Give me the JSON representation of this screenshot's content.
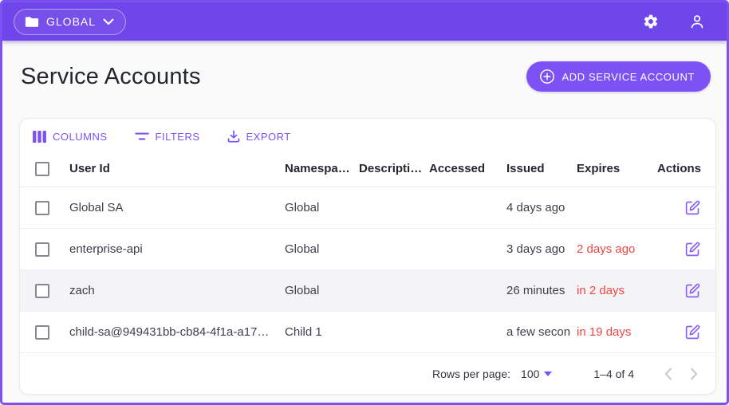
{
  "colors": {
    "appbar_bg": "#6f46e9",
    "accent": "#7c52f5",
    "edit_icon": "#8b5ff6",
    "danger": "#ef4643",
    "page_bg": "#fafafa",
    "highlight_row_bg": "#f4f4f6"
  },
  "appbar": {
    "org_selector": {
      "label": "GLOBAL",
      "icon": "folder-icon",
      "caret": "chevron-down-icon"
    },
    "settings_icon": "gear-icon",
    "account_icon": "person-icon"
  },
  "page": {
    "title": "Service Accounts",
    "add_button": {
      "label": "ADD SERVICE ACCOUNT",
      "icon": "plus-circle-icon"
    }
  },
  "toolbar": {
    "columns_label": "COLUMNS",
    "filters_label": "FILTERS",
    "export_label": "EXPORT",
    "icons": [
      "columns-icon",
      "filter-icon",
      "download-icon"
    ]
  },
  "table": {
    "columns": [
      "User Id",
      "Namespa…",
      "Descripti…",
      "Accessed",
      "Issued",
      "Expires",
      "Actions"
    ],
    "rows": [
      {
        "user_id": "Global SA",
        "namespace": "Global",
        "description": "",
        "accessed": "",
        "issued": "4 days ago",
        "expires": "",
        "expires_danger": false,
        "highlighted": false
      },
      {
        "user_id": "enterprise-api",
        "namespace": "Global",
        "description": "",
        "accessed": "",
        "issued": "3 days ago",
        "expires": "2 days ago",
        "expires_danger": true,
        "highlighted": false
      },
      {
        "user_id": "zach",
        "namespace": "Global",
        "description": "",
        "accessed": "",
        "issued": "26 minutes",
        "expires": "in 2 days",
        "expires_danger": true,
        "highlighted": true
      },
      {
        "user_id": "child-sa@949431bb-cb84-4f1a-a17…",
        "namespace": "Child 1",
        "description": "",
        "accessed": "",
        "issued": "a few secon",
        "expires": "in 19 days",
        "expires_danger": true,
        "highlighted": false
      }
    ],
    "row_action_icon": "edit-icon"
  },
  "footer": {
    "rows_per_page_label": "Rows per page:",
    "rows_per_page_value": "100",
    "range_label": "1–4 of 4",
    "prev_icon": "chevron-left-icon",
    "next_icon": "chevron-right-icon"
  }
}
